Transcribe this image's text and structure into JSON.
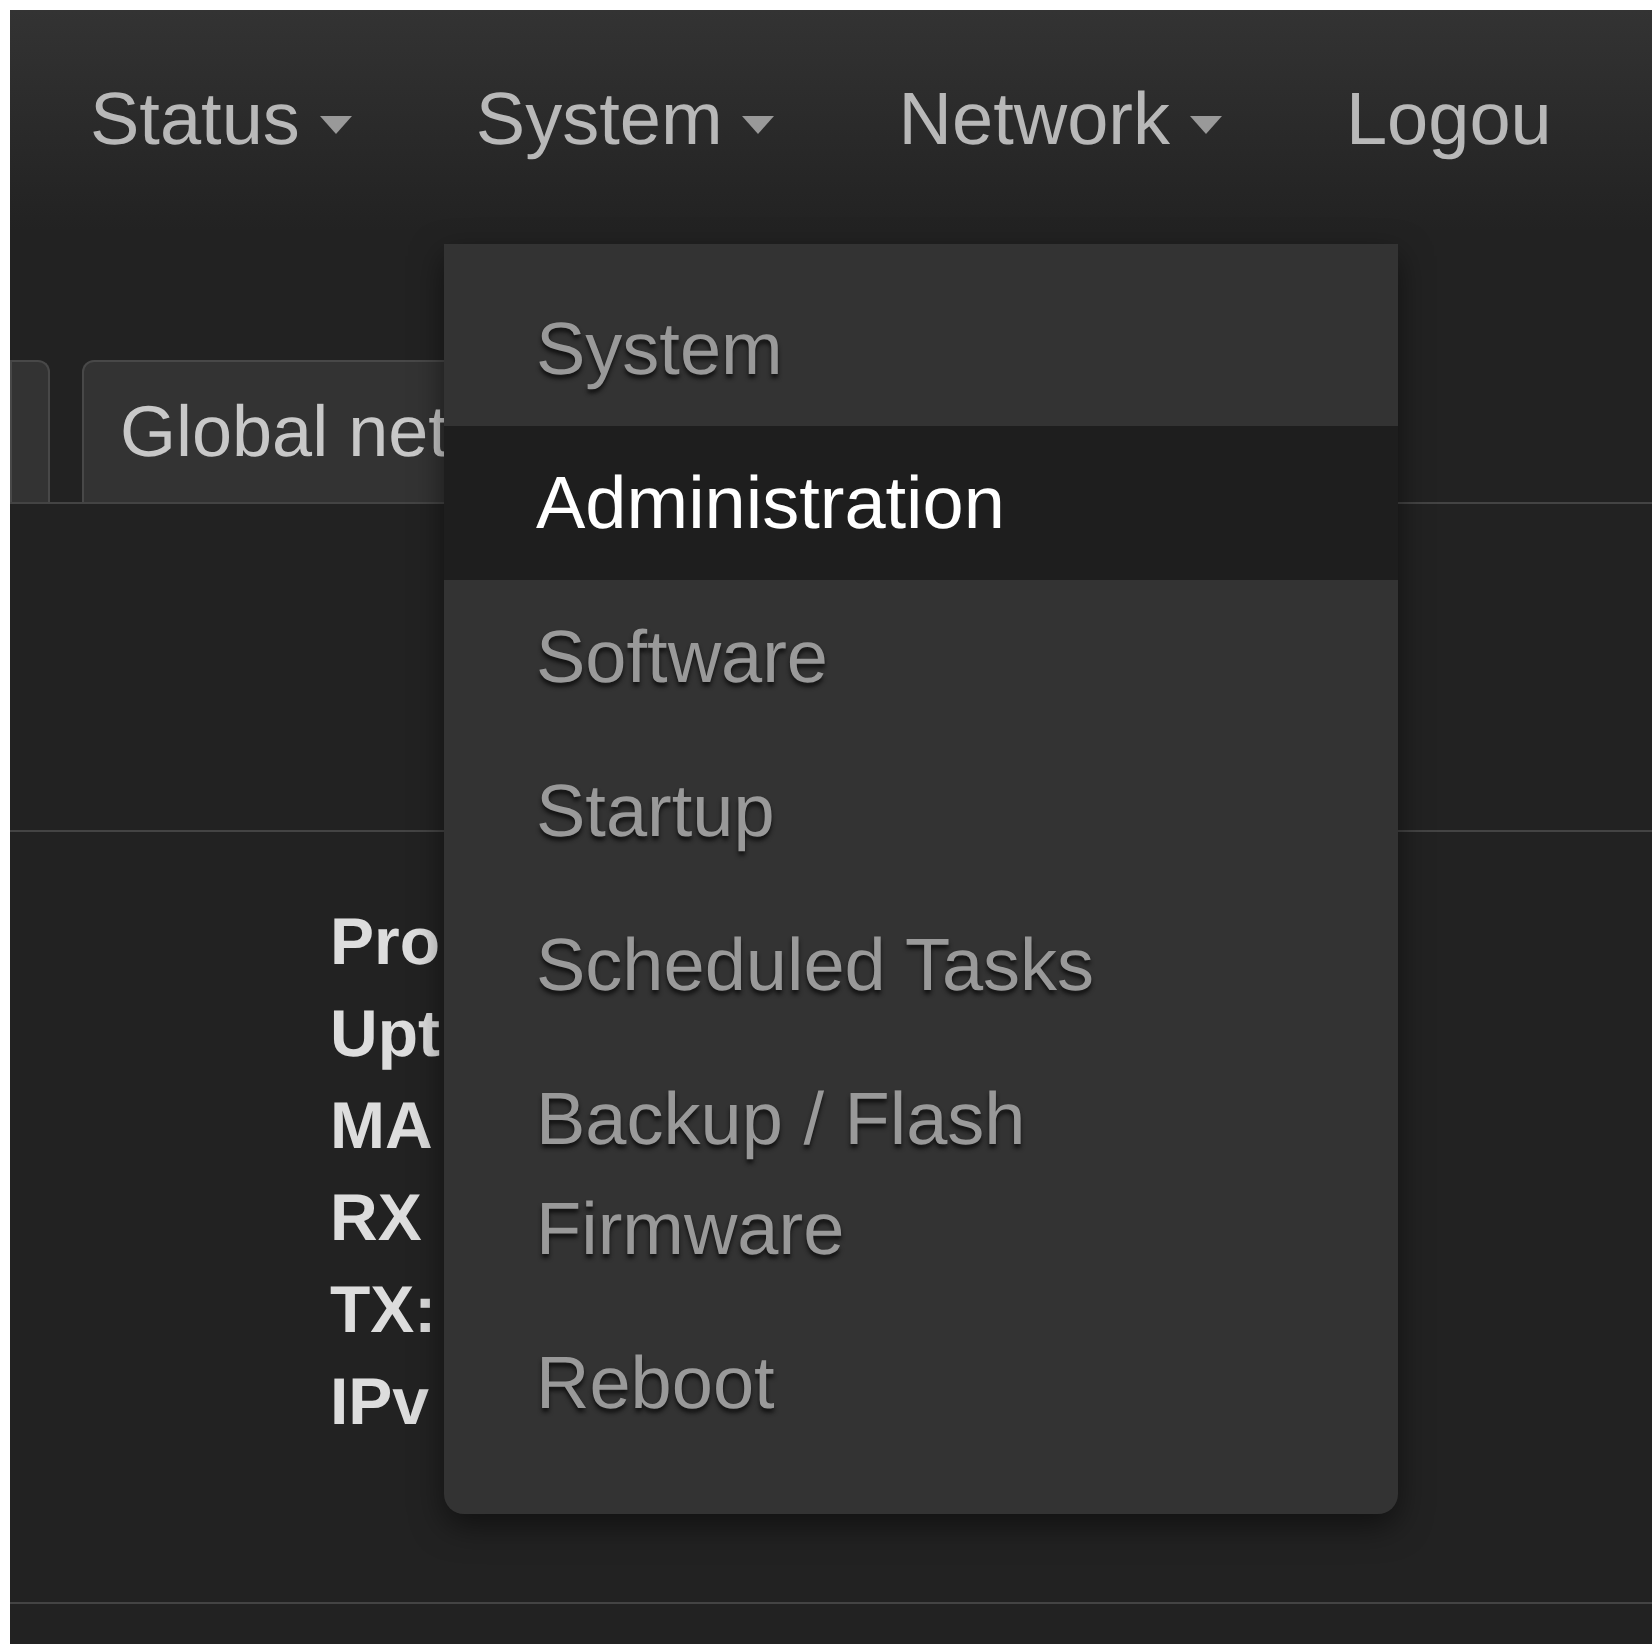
{
  "navbar": {
    "items": [
      {
        "label": "Status",
        "kind": "dropdown"
      },
      {
        "label": "System",
        "kind": "dropdown"
      },
      {
        "label": "Network",
        "kind": "dropdown"
      },
      {
        "label": "Logou",
        "kind": "link"
      }
    ]
  },
  "tabs": [
    {
      "kind": "edge",
      "selected": false
    },
    {
      "kind": "tab",
      "label": "Global net",
      "selected": false
    }
  ],
  "fields": [
    {
      "label": "Pro"
    },
    {
      "label": "Upt"
    },
    {
      "label": "MA"
    },
    {
      "label": "RX"
    },
    {
      "label": "TX:"
    },
    {
      "label": "IPv"
    }
  ],
  "dropdown": {
    "items": [
      {
        "label": "System",
        "selected": false
      },
      {
        "label": "Administration",
        "selected": true
      },
      {
        "label": "Software",
        "selected": false
      },
      {
        "label": "Startup",
        "selected": false
      },
      {
        "label": "Scheduled Tasks",
        "selected": false
      },
      {
        "label": "Backup / Flash Firmware",
        "selected": false
      },
      {
        "label": "Reboot",
        "selected": false
      }
    ]
  }
}
